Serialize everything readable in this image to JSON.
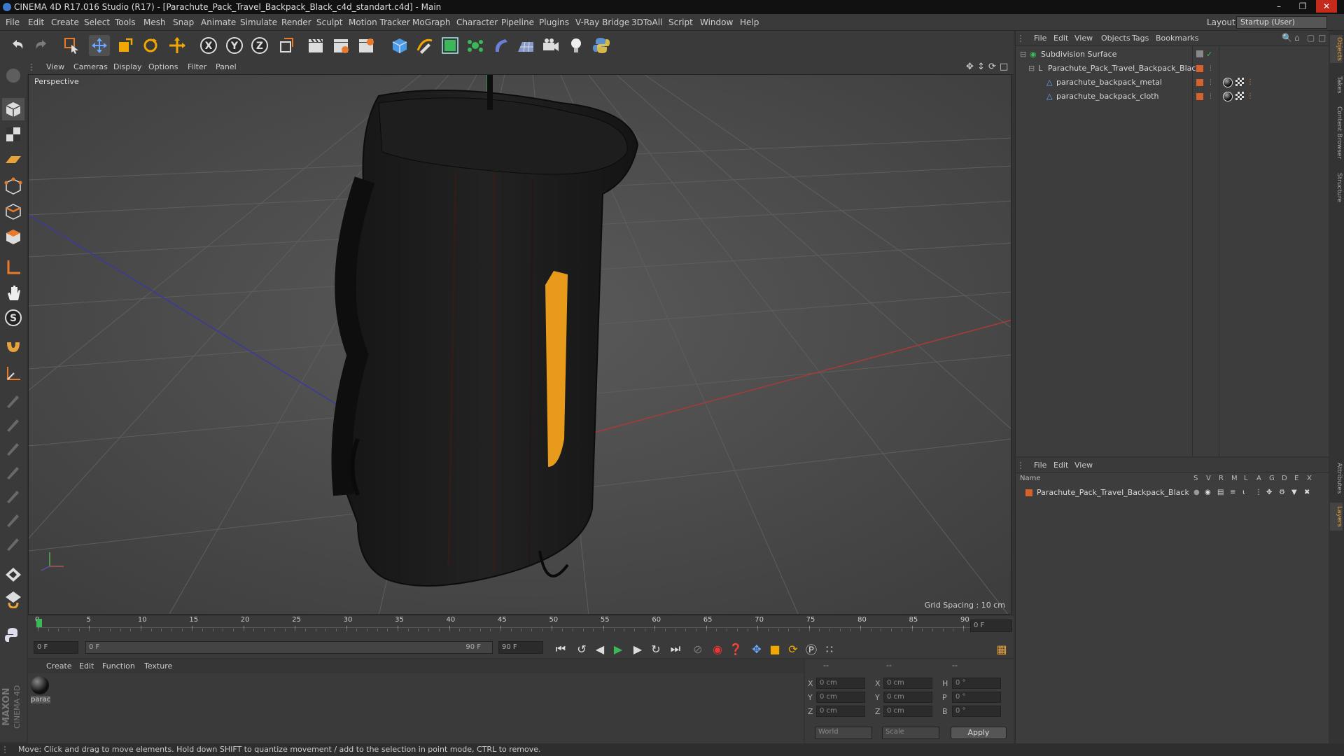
{
  "window": {
    "title": "CINEMA 4D R17.016 Studio (R17) - [Parachute_Pack_Travel_Backpack_Black_c4d_standart.c4d] - Main"
  },
  "menubar": {
    "items": [
      "File",
      "Edit",
      "Create",
      "Select",
      "Tools",
      "Mesh",
      "Snap",
      "Animate",
      "Simulate",
      "Render",
      "Sculpt",
      "Motion Tracker",
      "MoGraph",
      "Character",
      "Pipeline",
      "Plugins",
      "V-Ray Bridge",
      "3DToAll",
      "Script",
      "Window",
      "Help"
    ],
    "layout_label": "Layout:",
    "layout_value": "Startup (User)"
  },
  "viewport": {
    "menu": [
      "View",
      "Cameras",
      "Display",
      "Options",
      "Filter",
      "Panel"
    ],
    "camera_label": "Perspective",
    "grid_spacing": "Grid Spacing : 10 cm"
  },
  "timeline": {
    "ticks": [
      "0",
      "5",
      "10",
      "15",
      "20",
      "25",
      "30",
      "35",
      "40",
      "45",
      "50",
      "55",
      "60",
      "65",
      "70",
      "75",
      "80",
      "85",
      "90"
    ],
    "current_frame": "0 F",
    "start_field": "0 F",
    "range_start": "0 F",
    "range_end": "90 F",
    "end_field": "90 F"
  },
  "material_manager": {
    "menu": [
      "Create",
      "Edit",
      "Function",
      "Texture"
    ],
    "materials": [
      {
        "name": "parac"
      }
    ]
  },
  "coordinates": {
    "headers": [
      "--",
      "--",
      "--"
    ],
    "rows": [
      {
        "a": "X",
        "av": "0 cm",
        "b": "X",
        "bv": "0 cm",
        "c": "H",
        "cv": "0 °"
      },
      {
        "a": "Y",
        "av": "0 cm",
        "b": "Y",
        "bv": "0 cm",
        "c": "P",
        "cv": "0 °"
      },
      {
        "a": "Z",
        "av": "0 cm",
        "b": "Z",
        "bv": "0 cm",
        "c": "B",
        "cv": "0 °"
      }
    ],
    "mode_world": "World",
    "mode_scale": "Scale",
    "apply_label": "Apply"
  },
  "object_manager": {
    "menu": [
      "File",
      "Edit",
      "View",
      "Objects",
      "Tags",
      "Bookmarks"
    ],
    "objects": [
      {
        "name": "Subdivision Surface"
      },
      {
        "name": "Parachute_Pack_Travel_Backpack_Black"
      },
      {
        "name": "parachute_backpack_metal"
      },
      {
        "name": "parachute_backpack_cloth"
      }
    ]
  },
  "layer_manager": {
    "menu": [
      "File",
      "Edit",
      "View"
    ],
    "col_name": "Name",
    "cols": [
      "S",
      "V",
      "R",
      "M",
      "L",
      "A",
      "G",
      "D",
      "E",
      "X"
    ],
    "layers": [
      {
        "name": "Parachute_Pack_Travel_Backpack_Black"
      }
    ]
  },
  "right_tabs": [
    "Objects",
    "Takes",
    "Content Browser",
    "Structure",
    "Attributes",
    "Layers"
  ],
  "brand": {
    "line1": "MAXON",
    "line2": "CINEMA 4D"
  },
  "status": {
    "text": "Move: Click and drag to move elements. Hold down SHIFT to quantize movement / add to the selection in point mode, CTRL to remove."
  },
  "colors": {
    "accent_orange": "#e87a2a",
    "layer_orange": "#d4622a",
    "selection_blue": "#3c77c8"
  }
}
